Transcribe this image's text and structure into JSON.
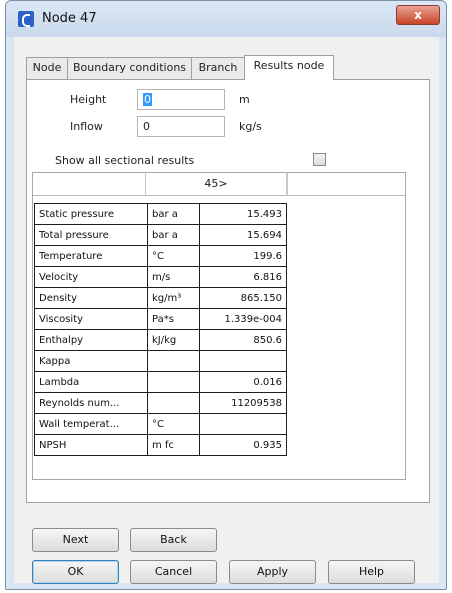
{
  "window": {
    "title": "Node 47",
    "close_glyph": "x"
  },
  "tabs": [
    {
      "label": "Node",
      "active": false
    },
    {
      "label": "Boundary conditions",
      "active": false
    },
    {
      "label": "Branch",
      "active": false
    },
    {
      "label": "Results node",
      "active": true
    }
  ],
  "fields": {
    "height": {
      "label": "Height",
      "value": "0",
      "unit": "m"
    },
    "inflow": {
      "label": "Inflow",
      "value": "0",
      "unit": "kg/s"
    }
  },
  "show_all_sectional": {
    "label": "Show all sectional results",
    "checked": false
  },
  "results": {
    "column_header": "45>",
    "rows": [
      {
        "name": "Static pressure",
        "unit": "bar a",
        "value": "15.493"
      },
      {
        "name": "Total pressure",
        "unit": "bar a",
        "value": "15.694"
      },
      {
        "name": "Temperature",
        "unit": "°C",
        "value": "199.6"
      },
      {
        "name": "Velocity",
        "unit": "m/s",
        "value": "6.816"
      },
      {
        "name": "Density",
        "unit": "kg/m³",
        "value": "865.150"
      },
      {
        "name": "Viscosity",
        "unit": "Pa*s",
        "value": "1.339e-004"
      },
      {
        "name": "Enthalpy",
        "unit": "kJ/kg",
        "value": "850.6"
      },
      {
        "name": "Kappa",
        "unit": "",
        "value": ""
      },
      {
        "name": "Lambda",
        "unit": "",
        "value": "0.016"
      },
      {
        "name": "Reynolds num...",
        "unit": "",
        "value": "11209538"
      },
      {
        "name": "Wall temperat...",
        "unit": "°C",
        "value": ""
      },
      {
        "name": "NPSH",
        "unit": "m fc",
        "value": "0.935"
      }
    ]
  },
  "buttons": {
    "next": "Next",
    "back": "Back",
    "ok": "OK",
    "cancel": "Cancel",
    "apply": "Apply",
    "help": "Help"
  },
  "colors": {
    "title_icon": "#2a62c9",
    "close_button": "#c8442a",
    "selection": "#3399ff"
  }
}
